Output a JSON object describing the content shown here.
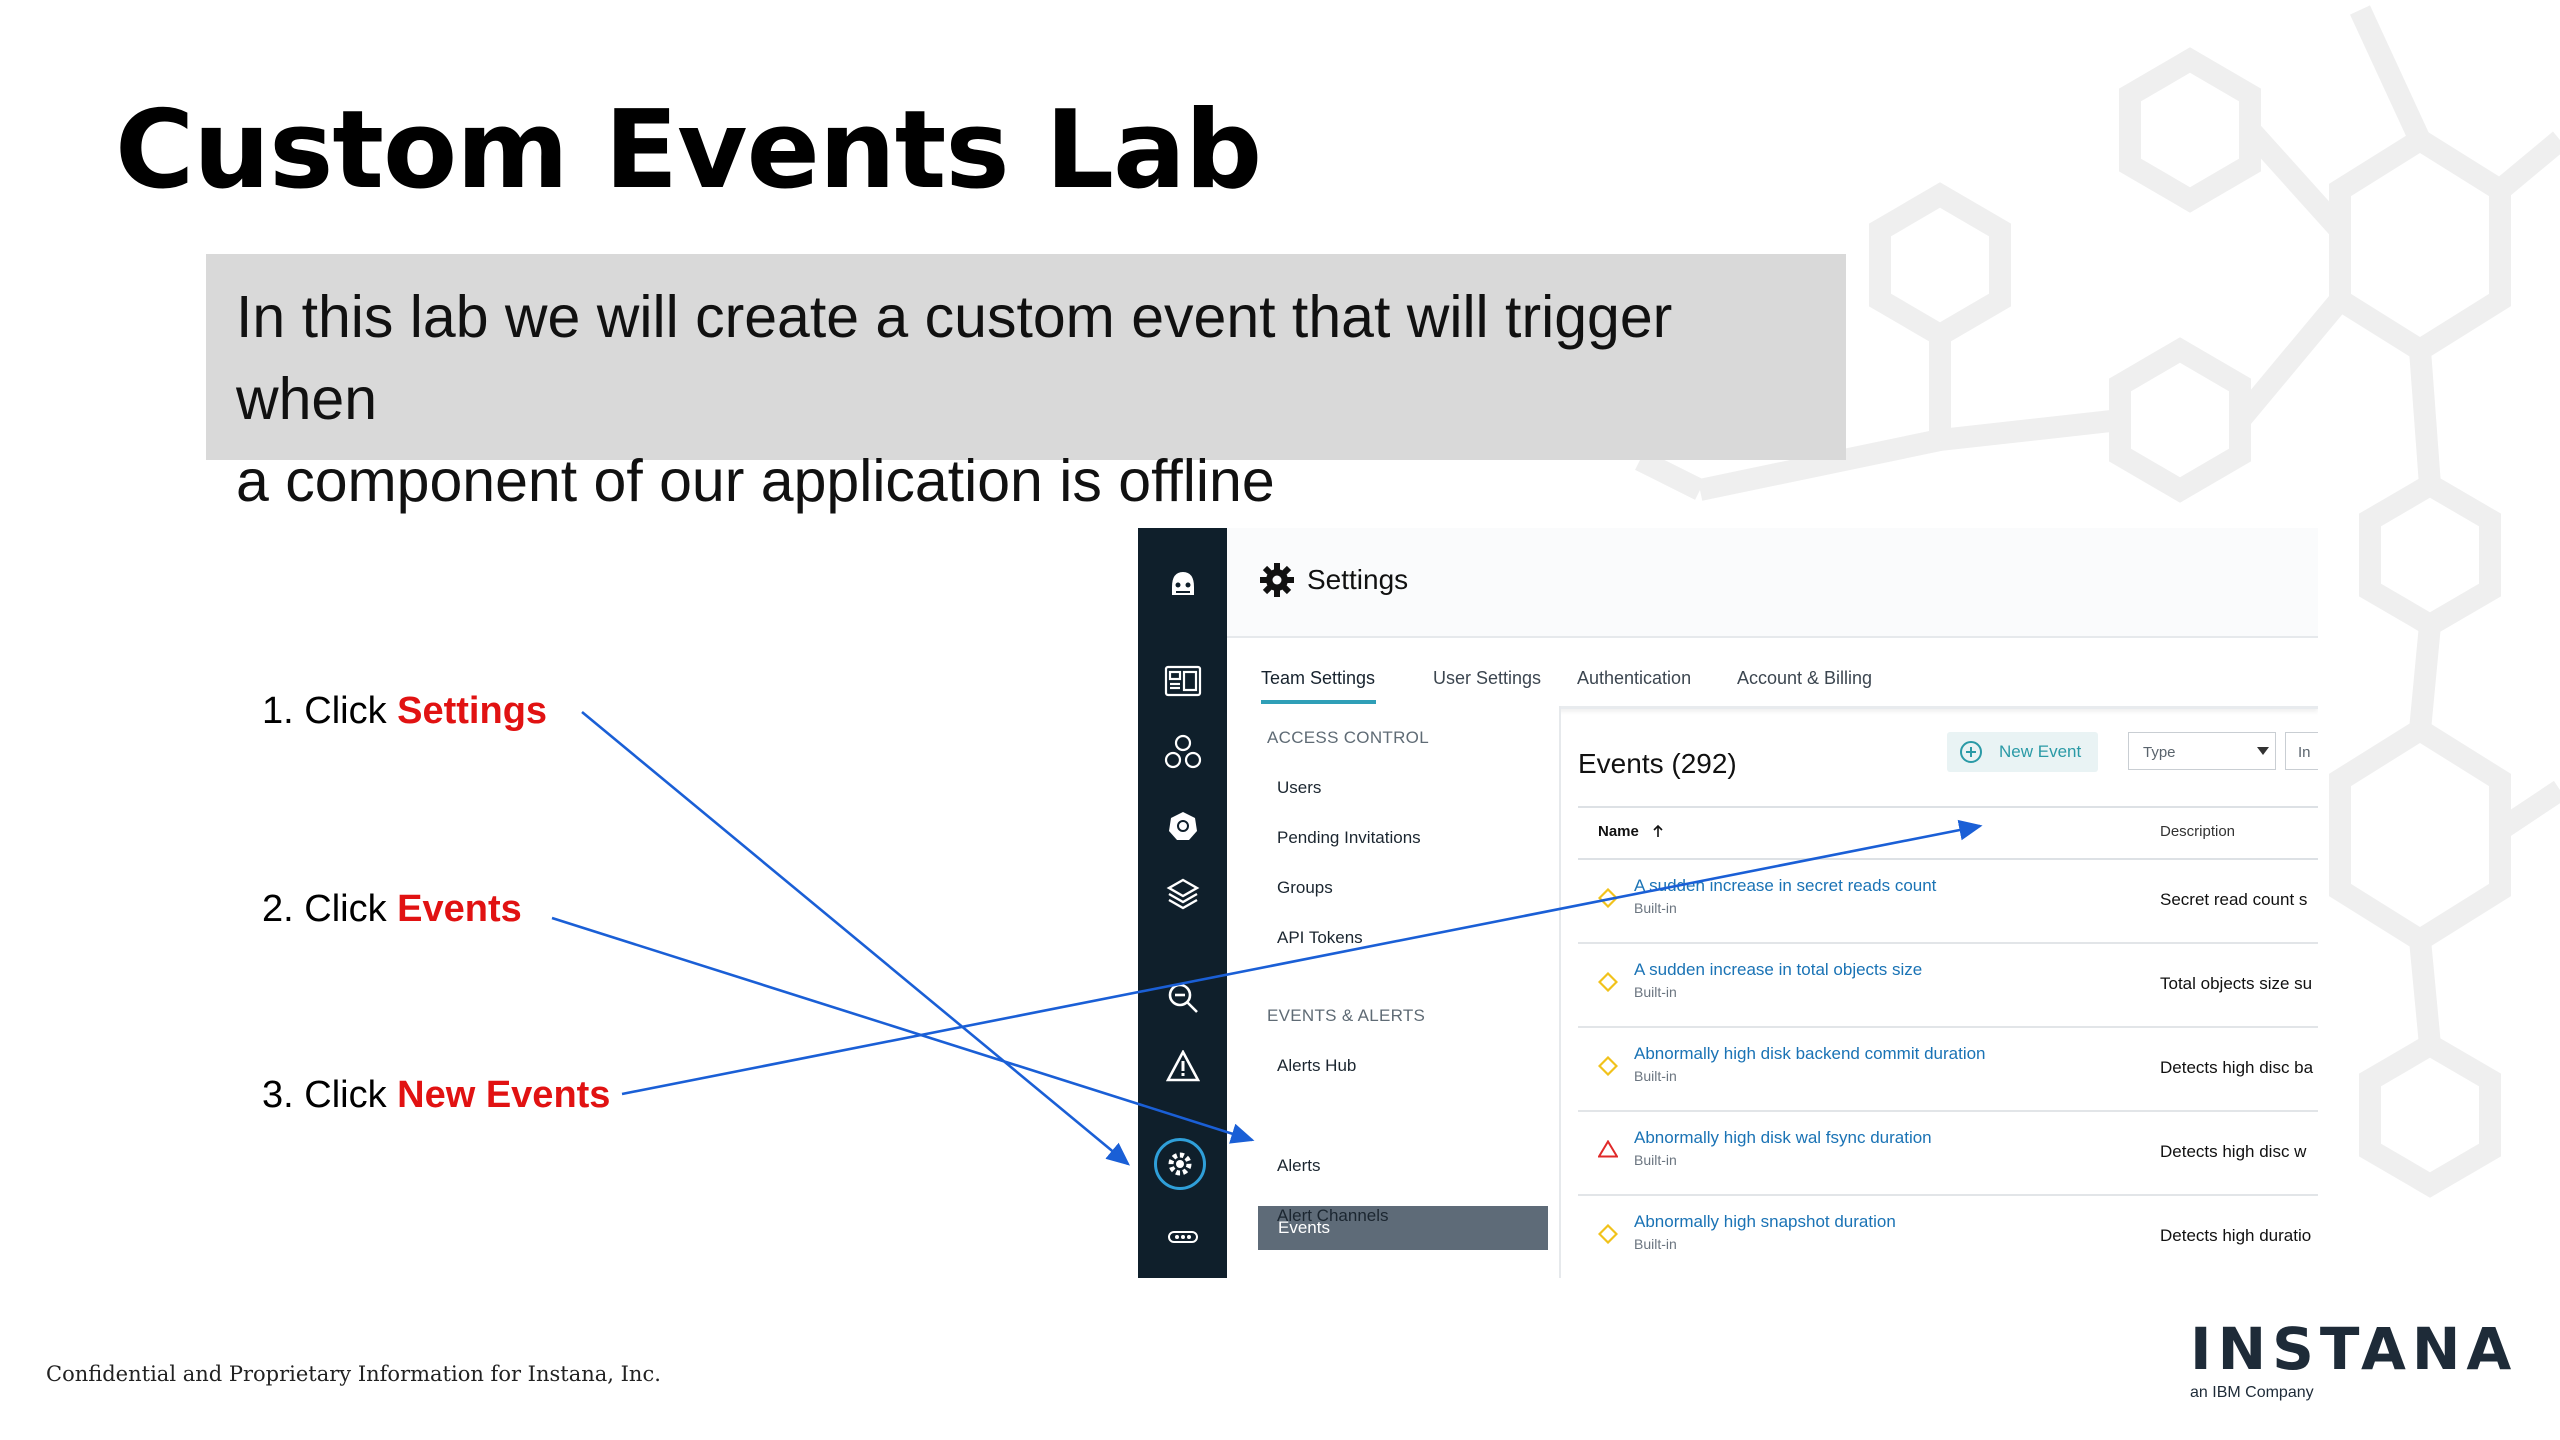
{
  "slide": {
    "title": "Custom Events Lab",
    "intro_line1": "In this lab we will create a custom event that will trigger when",
    "intro_line2": "a component of our application is offline",
    "steps": [
      {
        "prefix": "1. Click ",
        "highlight": "Settings"
      },
      {
        "prefix": "2. Click ",
        "highlight": "Events"
      },
      {
        "prefix": "3. Click ",
        "highlight": "New Events"
      }
    ],
    "footer": "Confidential and Proprietary Information for Instana, Inc.",
    "logo_word": "INSTANA",
    "logo_sub": "an IBM Company",
    "highlight_color": "#e11212",
    "arrow_color": "#1a5fd6"
  },
  "app": {
    "title": "Settings",
    "sidebar_icons": [
      "robot-icon",
      "dashboard-icon",
      "applications-icon",
      "kubernetes-icon",
      "layers-icon",
      "analyze-icon",
      "events-warning-icon",
      "settings-gear-icon",
      "more-icon"
    ],
    "tabs": [
      "Team Settings",
      "User Settings",
      "Authentication",
      "Account & Billing"
    ],
    "nav": {
      "access_header": "ACCESS CONTROL",
      "access_items": [
        "Users",
        "Pending Invitations",
        "Groups",
        "API Tokens"
      ],
      "events_header": "EVENTS & ALERTS",
      "events_items": [
        "Alerts Hub",
        "Events",
        "Alerts",
        "Alert Channels"
      ]
    },
    "events": {
      "title": "Events (292)",
      "new_event": "New Event",
      "type_filter": "Type",
      "second_filter": "In",
      "col_name": "Name",
      "col_desc": "Description",
      "rows": [
        {
          "name": "A sudden increase in secret reads count",
          "sub": "Built-in",
          "desc": "Secret read count s",
          "severity": "warning"
        },
        {
          "name": "A sudden increase in total objects size",
          "sub": "Built-in",
          "desc": "Total objects size su",
          "severity": "warning"
        },
        {
          "name": "Abnormally high disk backend commit duration",
          "sub": "Built-in",
          "desc": "Detects high disc ba",
          "severity": "warning"
        },
        {
          "name": "Abnormally high disk wal fsync duration",
          "sub": "Built-in",
          "desc": "Detects high disc w",
          "severity": "critical"
        },
        {
          "name": "Abnormally high snapshot duration",
          "sub": "Built-in",
          "desc": "Detects high duratio",
          "severity": "warning"
        }
      ]
    }
  }
}
